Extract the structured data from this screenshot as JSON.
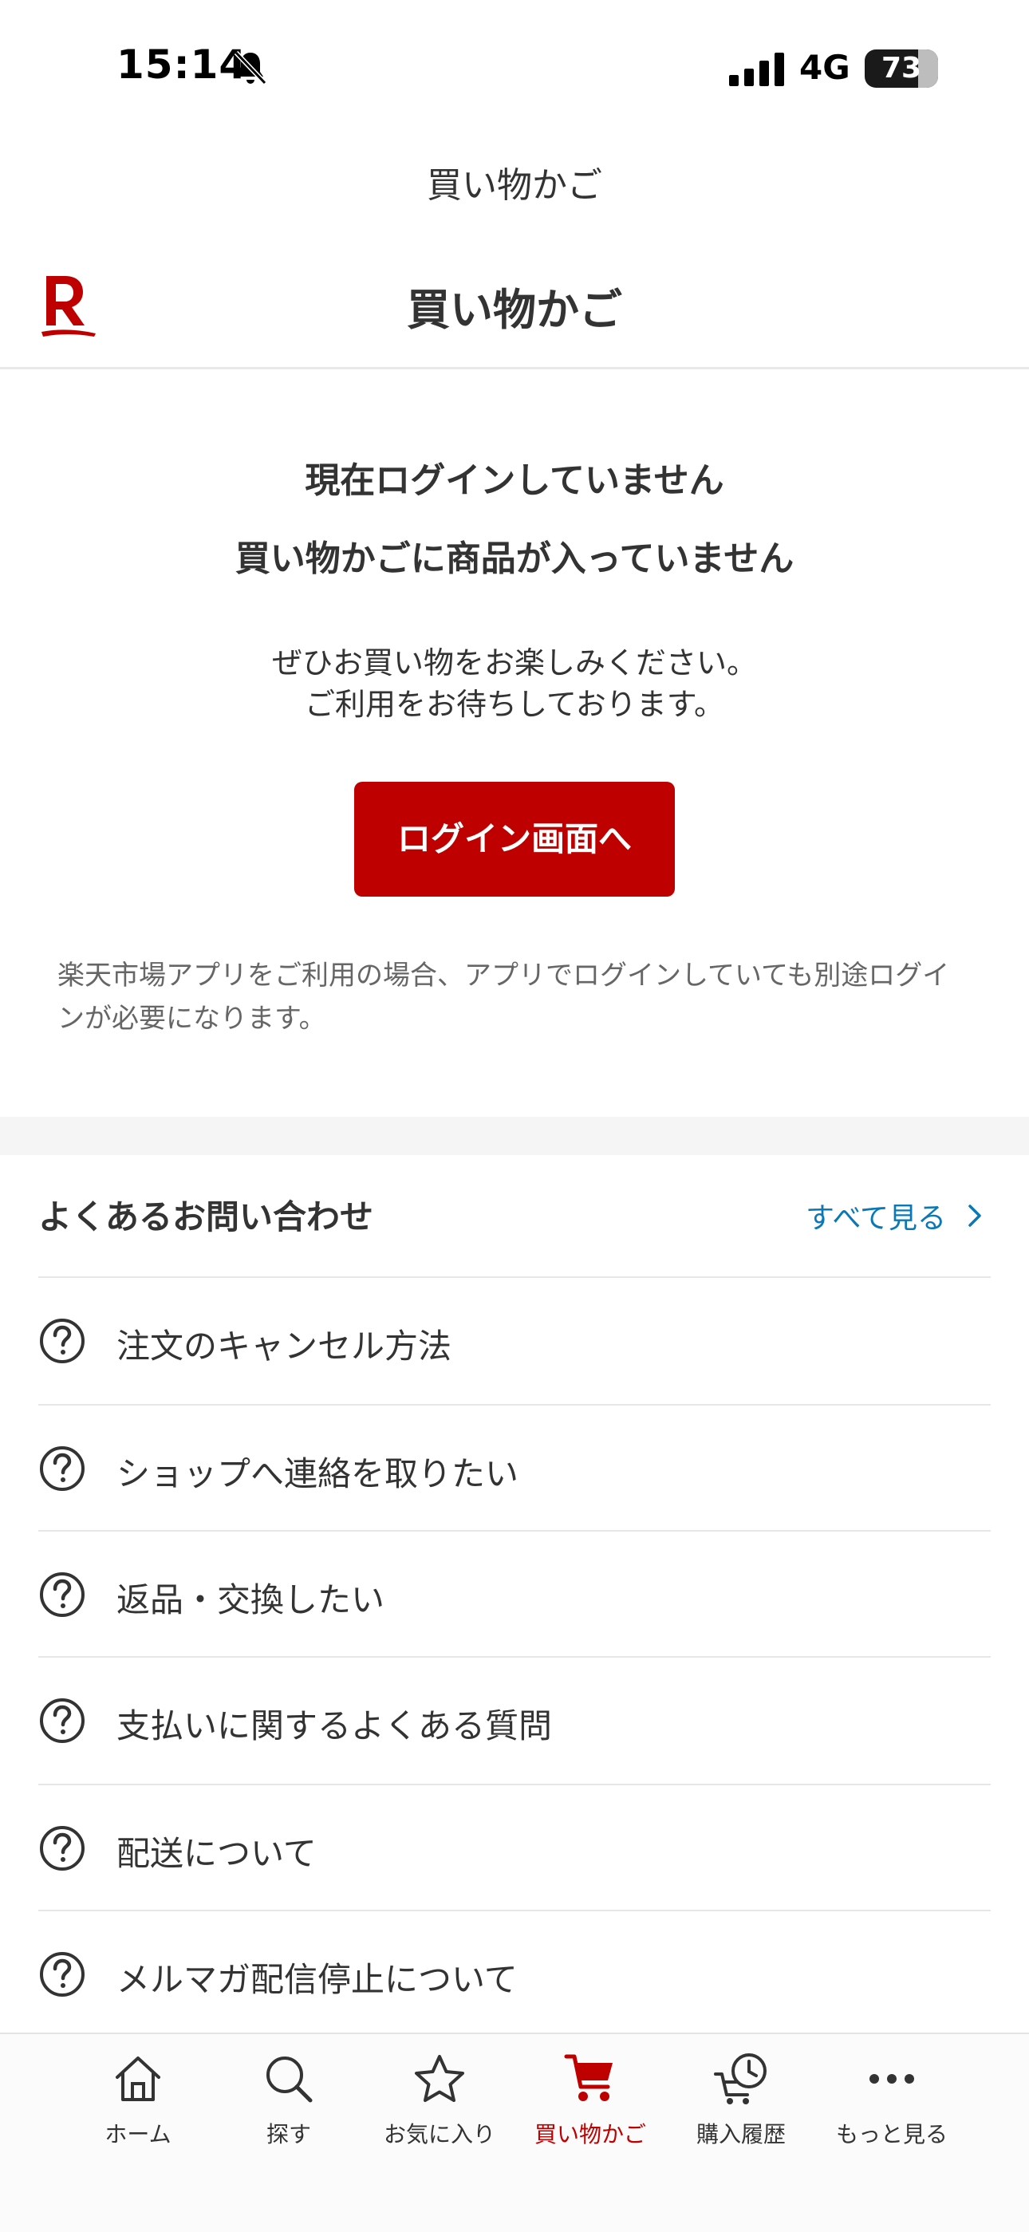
{
  "status_bar": {
    "time": "15:14",
    "network": "4G",
    "battery": "73",
    "battery_level": 0.73
  },
  "browser": {
    "title": "買い物かご"
  },
  "header": {
    "title": "買い物かご",
    "logo_icon": "rakuten-logo"
  },
  "empty_state": {
    "line1": "現在ログインしていません",
    "line2": "買い物かごに商品が入っていません",
    "line3": "ぜひお買い物をお楽しみください。",
    "line4": "ご利用をお待ちしております。",
    "login_button": "ログイン画面へ",
    "note": "楽天市場アプリをご利用の場合、アプリでログインしていても別途ログインが必要になります。"
  },
  "faq": {
    "heading": "よくあるお問い合わせ",
    "see_all": "すべて見る",
    "items": [
      {
        "label": "注文のキャンセル方法"
      },
      {
        "label": "ショップへ連絡を取りたい"
      },
      {
        "label": "返品・交換したい"
      },
      {
        "label": "支払いに関するよくある質問"
      },
      {
        "label": "配送について"
      },
      {
        "label": "メルマガ配信停止について"
      }
    ]
  },
  "tabbar": {
    "active": "cart",
    "items": [
      {
        "label": "ホーム",
        "icon": "home-icon"
      },
      {
        "label": "探す",
        "icon": "search-icon"
      },
      {
        "label": "お気に入り",
        "icon": "star-icon"
      },
      {
        "label": "買い物かご",
        "icon": "cart-icon"
      },
      {
        "label": "購入履歴",
        "icon": "history-icon"
      },
      {
        "label": "もっと見る",
        "icon": "more-icon"
      }
    ]
  },
  "colors": {
    "brand": "#bf0000",
    "link": "#0a78b6",
    "text": "#333333",
    "muted": "#666666"
  }
}
